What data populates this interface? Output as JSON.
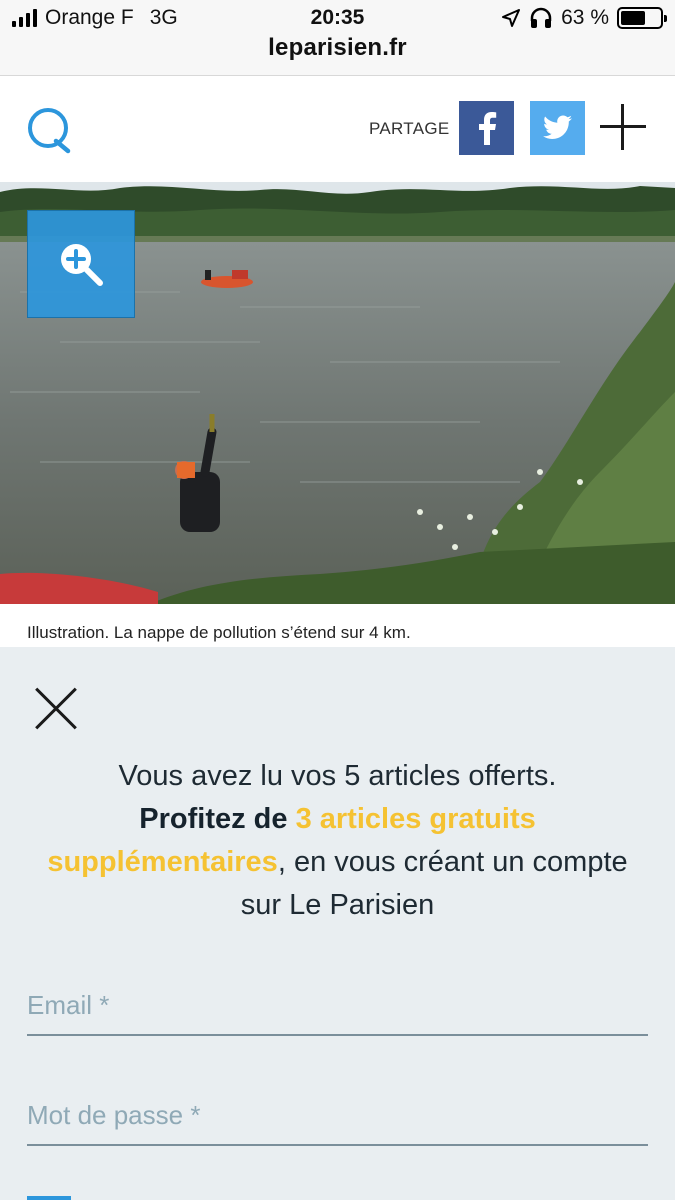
{
  "status_bar": {
    "carrier": "Orange F",
    "network": "3G",
    "time": "20:35",
    "battery_percent": "63 %",
    "battery_level": 0.63,
    "url": "leparisien.fr",
    "icons": [
      "signal-icon",
      "location-arrow-icon",
      "headphones-icon",
      "battery-icon"
    ]
  },
  "header": {
    "logo_icon": "le-parisien-q-logo-icon",
    "share_label": "PARTAGE",
    "buttons": [
      "facebook-icon",
      "twitter-icon",
      "plus-icon"
    ],
    "colors": {
      "facebook": "#3b5998",
      "twitter": "#55acee",
      "logo": "#2c96dc"
    }
  },
  "article": {
    "image": "river-pollution-photo",
    "zoom_icon": "zoom-in-icon",
    "caption": "Illustration. La nappe de pollution s’étend sur 4 km."
  },
  "modal": {
    "line1": "Vous avez lu vos 5 articles offerts.",
    "bold_part": "Profitez de",
    "highlight": "3 articles gratuits supplémentaires",
    "rest": ", en vous créant un compte sur Le Parisien",
    "email_placeholder": "Email *",
    "password_placeholder": "Mot de passe *",
    "colors": {
      "background": "#e9eef1",
      "highlight": "#f5c232"
    }
  }
}
